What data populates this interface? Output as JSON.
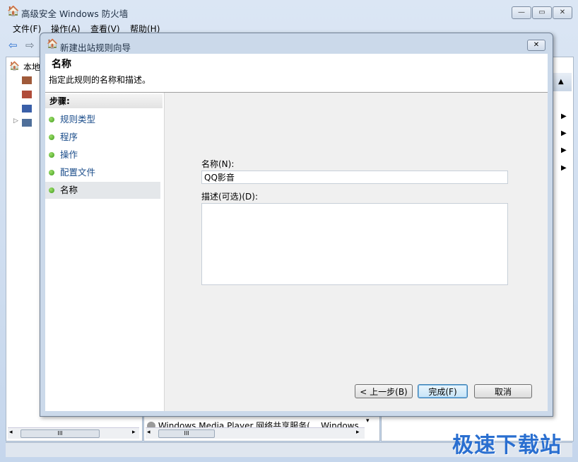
{
  "app": {
    "title": "高级安全 Windows 防火墙",
    "menu": [
      "文件(F)",
      "操作(A)",
      "查看(V)",
      "帮助(H)"
    ],
    "tree_root": "本地",
    "middle_row_text": "Windows Media Player 网络共享服务(... Windows",
    "scroll_marker": "III"
  },
  "dialog": {
    "title": "新建出站规则向导",
    "heading": "名称",
    "subheading": "指定此规则的名称和描述。",
    "steps_title": "步骤:",
    "steps": [
      {
        "label": "规则类型",
        "state": "done"
      },
      {
        "label": "程序",
        "state": "done"
      },
      {
        "label": "操作",
        "state": "done"
      },
      {
        "label": "配置文件",
        "state": "done"
      },
      {
        "label": "名称",
        "state": "current"
      }
    ],
    "name_label": "名称(N):",
    "name_value": "QQ影音",
    "desc_label": "描述(可选)(D):",
    "desc_value": "",
    "buttons": {
      "back": "< 上一步(B)",
      "finish": "完成(F)",
      "cancel": "取消"
    }
  },
  "watermark": "极速下载站"
}
